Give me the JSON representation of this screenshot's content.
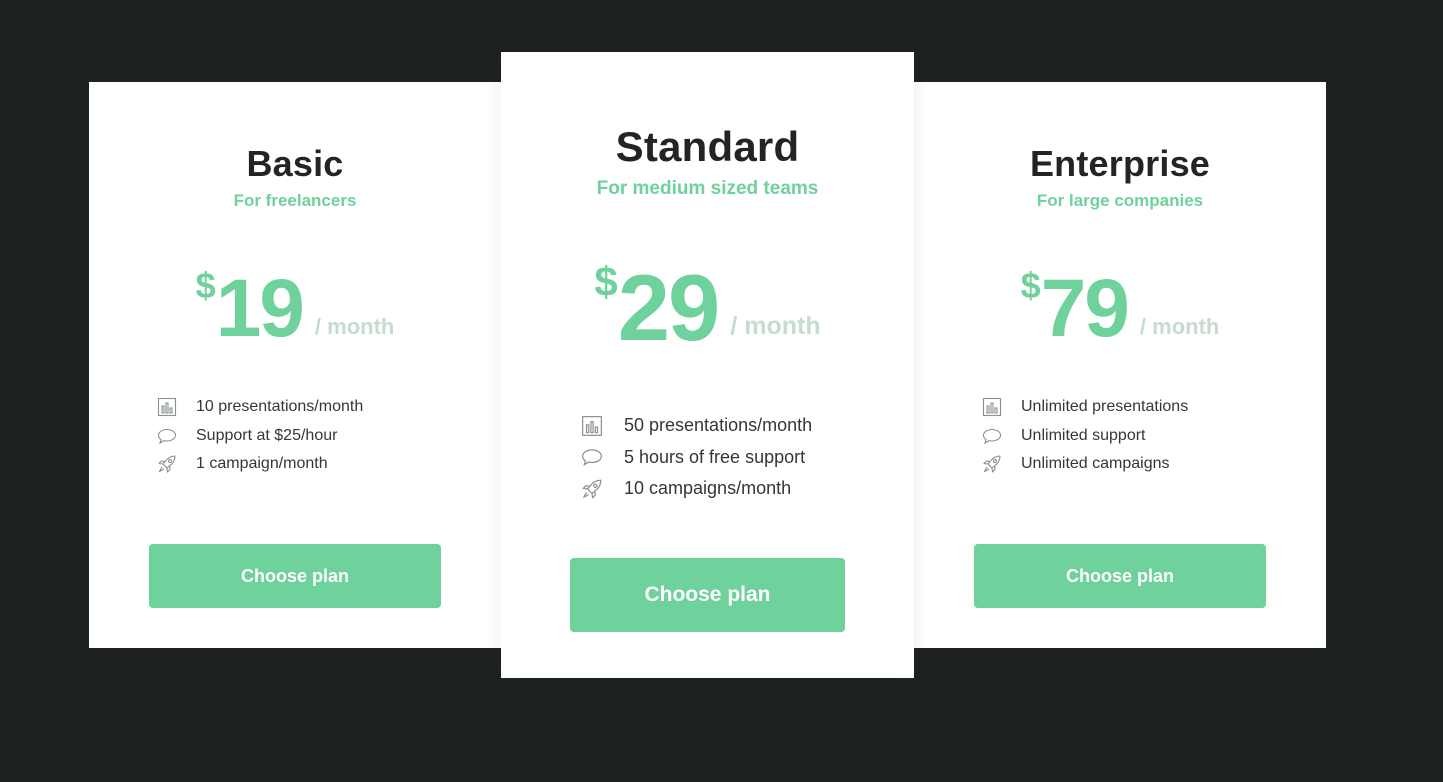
{
  "plans": {
    "basic": {
      "name": "Basic",
      "subtitle": "For freelancers",
      "currency": "$",
      "price": "19",
      "period": "/ month",
      "features": [
        {
          "icon": "bar-chart-icon",
          "text": "10 presentations/month"
        },
        {
          "icon": "speech-bubble-icon",
          "text": "Support at $25/hour"
        },
        {
          "icon": "rocket-icon",
          "text": "1 campaign/month"
        }
      ],
      "button_label": "Choose plan"
    },
    "standard": {
      "name": "Standard",
      "subtitle": "For medium sized teams",
      "currency": "$",
      "price": "29",
      "period": "/ month",
      "features": [
        {
          "icon": "bar-chart-icon",
          "text": "50 presentations/month"
        },
        {
          "icon": "speech-bubble-icon",
          "text": "5 hours of free support"
        },
        {
          "icon": "rocket-icon",
          "text": "10 campaigns/month"
        }
      ],
      "button_label": "Choose plan"
    },
    "enterprise": {
      "name": "Enterprise",
      "subtitle": "For large companies",
      "currency": "$",
      "price": "79",
      "period": "/ month",
      "features": [
        {
          "icon": "bar-chart-icon",
          "text": "Unlimited presentations"
        },
        {
          "icon": "speech-bubble-icon",
          "text": "Unlimited support"
        },
        {
          "icon": "rocket-icon",
          "text": "Unlimited campaigns"
        }
      ],
      "button_label": "Choose plan"
    }
  },
  "colors": {
    "background": "#1f2223",
    "card": "#ffffff",
    "accent": "#6fd19b",
    "period_text": "#c5dccf",
    "heading": "#222426",
    "body_text": "#33373a",
    "icon_stroke": "#8a8f92"
  }
}
